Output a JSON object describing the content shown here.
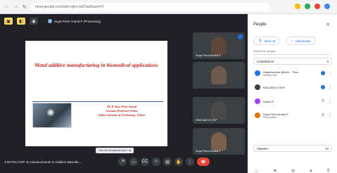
{
  "browser": {
    "url": "meet.google.com/xdm-qhro-txd?authuser=0"
  },
  "presenter": {
    "label": "Suya Prem Anand P (Presenting)"
  },
  "slide": {
    "title": "Metal additive manufacturing in biomedical applications",
    "author_line1": "Dr. P. Suya Prem Anand",
    "author_line2": "Assistant Professor Senior",
    "author_line3": "Vellore Institute of Technology, Vellore"
  },
  "tiles": [
    {
      "name": "Suya Prem Anand P",
      "color": "#5c4638"
    },
    {
      "name": "",
      "color": "#6d5a4c"
    },
    {
      "name": "HOD MECH 2DP",
      "color": "#4a4a4a"
    },
    {
      "name": "Suya Prem Anand P",
      "color": "#7a5f4a"
    }
  ],
  "bottom": {
    "time_title": "4:08 PM | FDP on Advancements in Additive Manufac...",
    "tooltip": "Turn off microphone (ctrl + d)"
  },
  "panel": {
    "title": "People",
    "mute_all": "Mute all",
    "add_people": "Add people",
    "search_placeholder": "Search for people",
    "contributors": "Contributors",
    "contributors_count": "4",
    "viewers": "Viewers",
    "viewers_count": "17",
    "people": [
      {
        "name": "Hayathunnisa (Meeti... Then",
        "sub": "Meeting host",
        "color": "#1a73e8"
      },
      {
        "name": "HOD MECH 2DP",
        "sub": "",
        "color": "#3c4043"
      },
      {
        "name": "Anand P",
        "sub": "",
        "color": "#a142f4"
      },
      {
        "name": "Suya Prem Anand P",
        "sub": "Presentation",
        "color": "#e37400"
      }
    ]
  }
}
